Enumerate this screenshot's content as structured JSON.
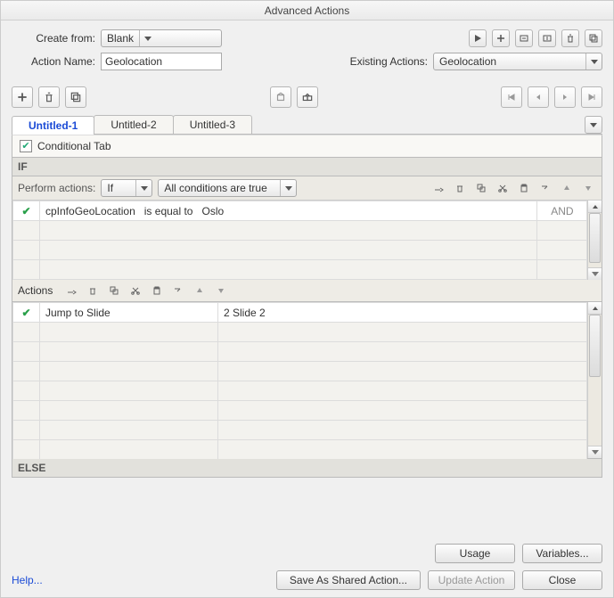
{
  "title": "Advanced Actions",
  "form": {
    "create_from_label": "Create from:",
    "create_from_value": "Blank",
    "action_name_label": "Action Name:",
    "action_name_value": "Geolocation",
    "existing_label": "Existing Actions:",
    "existing_value": "Geolocation"
  },
  "tabs": [
    "Untitled-1",
    "Untitled-2",
    "Untitled-3"
  ],
  "active_tab_index": 0,
  "conditional_tab_label": "Conditional Tab",
  "if_label": "IF",
  "perform": {
    "label": "Perform actions:",
    "mode": "If",
    "condition_scope": "All conditions are true"
  },
  "conditions": [
    {
      "field": "cpInfoGeoLocation",
      "op": "is equal to",
      "value": "Oslo",
      "logic": "AND"
    }
  ],
  "actions_label": "Actions",
  "actions": [
    {
      "action": "Jump to Slide",
      "target": "2 Slide 2"
    }
  ],
  "else_label": "ELSE",
  "buttons": {
    "usage": "Usage",
    "variables": "Variables...",
    "help": "Help...",
    "save_shared": "Save As Shared Action...",
    "update": "Update Action",
    "close": "Close"
  }
}
